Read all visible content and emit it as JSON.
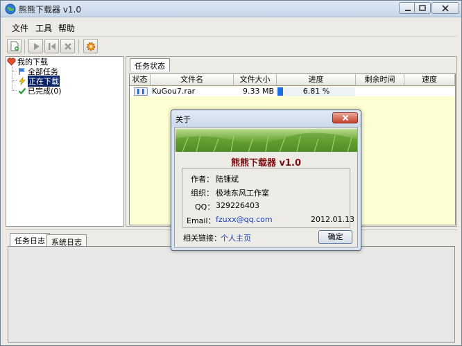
{
  "window": {
    "title": "熊熊下载器 v1.0"
  },
  "menu": [
    "文件",
    "工具",
    "帮助"
  ],
  "tree": {
    "root": "我的下载",
    "items": [
      "全部任务",
      "正在下载",
      "已完成(0)"
    ],
    "selected_index": 1
  },
  "panel_tab": "任务状态",
  "table": {
    "columns": [
      "状态",
      "文件名",
      "文件大小",
      "进度",
      "剩余时间",
      "速度"
    ],
    "rows": [
      {
        "file": "KuGou7.rar",
        "size": "9.33 MB",
        "progress": "6.81 %",
        "progress_fraction": 0.0681,
        "remaining": "",
        "speed": ""
      }
    ]
  },
  "log_tabs": [
    "任务日志",
    "系统日志"
  ],
  "about": {
    "title": "关于",
    "app_name": "熊熊下载器 v1.0",
    "author_label": "作者：",
    "author": "陆锺斌",
    "org_label": "组织：",
    "org": "极地东风工作室",
    "qq_label": "QQ：",
    "qq": "329226403",
    "email_label": "Email：",
    "email": "fzuxx@qq.com",
    "date": "2012.01.13",
    "links_label": "相关链接：",
    "homepage_link": "个人主页",
    "ok_label": "确定"
  },
  "colors": {
    "selection": "#0a246a",
    "list_background": "#fefed3",
    "app_name": "#7b0f12",
    "link": "#1c3fb0"
  }
}
